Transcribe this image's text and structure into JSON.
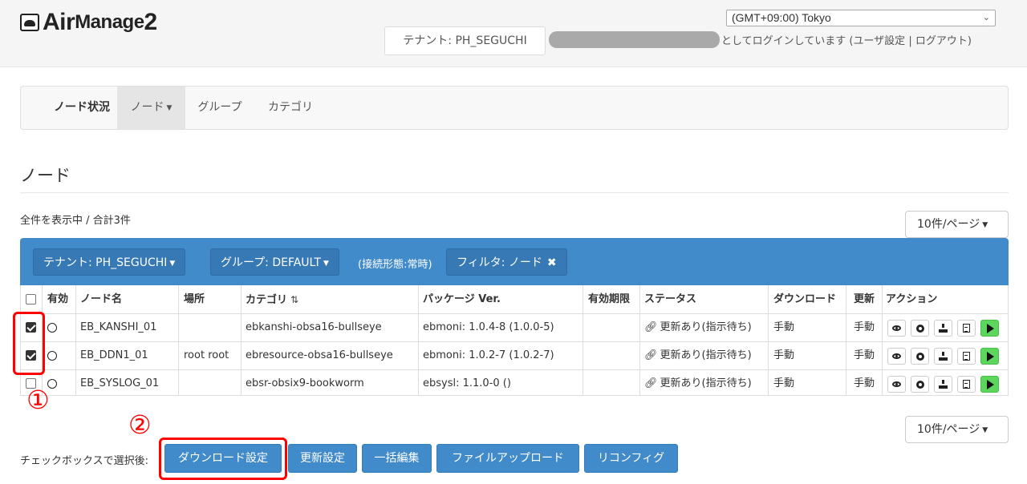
{
  "app": {
    "logo_air": "Air",
    "logo_manage": "Manage",
    "logo_two": "2"
  },
  "header": {
    "timezone_selected": "(GMT+09:00) Tokyo",
    "tenant_badge": "テナント: PH_SEGUCHI",
    "login_status": "としてログインしています (",
    "user_settings_link": "ユーザ設定",
    "separator": " | ",
    "logout_link": "ログアウト",
    "close_paren": ")"
  },
  "nav": {
    "tabs": [
      {
        "label": "ノード状況"
      },
      {
        "label": "ノード"
      },
      {
        "label": "グループ"
      },
      {
        "label": "カテゴリ"
      }
    ]
  },
  "page": {
    "title": "ノード",
    "count_text": "全件を表示中 / 合計3件",
    "per_page_top": "10件/ページ",
    "per_page_bottom": "10件/ページ"
  },
  "filters": {
    "tenant": "テナント: PH_SEGUCHI",
    "group": "グループ: DEFAULT",
    "conn_mode": "(接続形態:常時)",
    "filter": "フィルタ: ノード"
  },
  "table": {
    "headers": {
      "enabled": "有効",
      "name": "ノード名",
      "location": "場所",
      "category": "カテゴリ",
      "package": "パッケージ Ver.",
      "expiry": "有効期限",
      "status": "ステータス",
      "download": "ダウンロード",
      "update": "更新",
      "action": "アクション"
    },
    "rows": [
      {
        "checked": true,
        "name": "EB_KANSHI_01",
        "location": "",
        "category": "ebkanshi-obsa16-bullseye",
        "package": "ebmoni: 1.0.4-8 (1.0.0-5)",
        "expiry": "",
        "status": "更新あり(指示待ち)",
        "download": "手動",
        "update": "手動"
      },
      {
        "checked": true,
        "name": "EB_DDN1_01",
        "location": "root root",
        "category": "ebresource-obsa16-bullseye",
        "package": "ebmoni: 1.0.2-7 (1.0.2-7)",
        "expiry": "",
        "status": "更新あり(指示待ち)",
        "download": "手動",
        "update": "手動"
      },
      {
        "checked": false,
        "name": "EB_SYSLOG_01",
        "location": "",
        "category": "ebsr-obsix9-bookworm",
        "package": "ebsysl: 1.1.0-0 ()",
        "expiry": "",
        "status": "更新あり(指示待ち)",
        "download": "手動",
        "update": "手動"
      }
    ]
  },
  "bottom": {
    "label": "チェックボックスで選択後:",
    "buttons": [
      {
        "label": "ダウンロード設定"
      },
      {
        "label": "更新設定"
      },
      {
        "label": "一括編集"
      },
      {
        "label": "ファイルアップロード"
      },
      {
        "label": "リコンフィグ"
      }
    ]
  },
  "annotations": {
    "marker1": "①",
    "marker2": "②",
    "highlight_color": "#ff0000"
  },
  "colors": {
    "primary": "#428bca",
    "play_green": "#5cd65c"
  }
}
